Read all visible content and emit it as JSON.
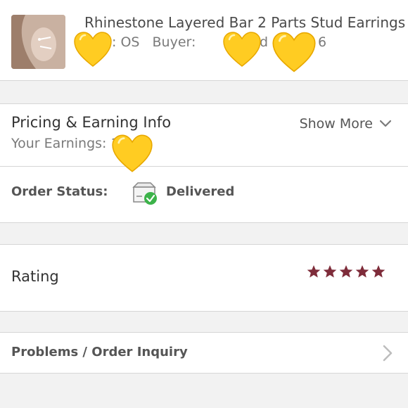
{
  "product": {
    "title": "Rhinestone Layered Bar 2 Parts Stud Earrings",
    "size": "Size: OS",
    "buyer": "Buyer:",
    "buyer_tail": "d",
    "order_tail": "6"
  },
  "pricing": {
    "title": "Pricing & Earning Info",
    "earnings_label": "Your Earnings:",
    "earnings_visible": "1",
    "show_more": "Show More"
  },
  "order_status": {
    "label": "Order Status:",
    "value": "Delivered",
    "icon": "package-delivered-icon",
    "check_color": "#3cb34a"
  },
  "rating": {
    "label": "Rating",
    "stars": 5,
    "max_stars": 5,
    "star_color": "#7e2c3a"
  },
  "problems": {
    "label": "Problems / Order Inquiry"
  },
  "overlays": {
    "emoji": "yellow-heart",
    "color": "#ffcc22"
  }
}
